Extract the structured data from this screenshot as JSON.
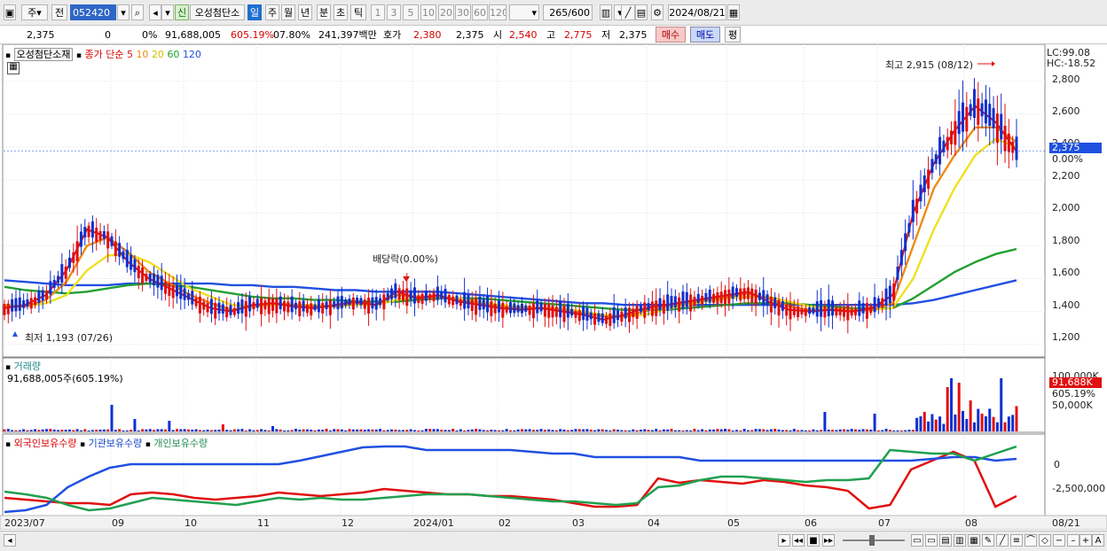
{
  "toolbar": {
    "mode_ju": "주",
    "mode_jeon": "전",
    "stock_code": "052420",
    "badge_sin": "신",
    "stock_name": "오성첨단소",
    "periods": [
      "일",
      "주",
      "월",
      "년",
      "분",
      "초",
      "틱"
    ],
    "numbers": [
      "1",
      "3",
      "5",
      "10",
      "20",
      "30",
      "60",
      "120"
    ],
    "count": "265",
    "count_total": "/600",
    "date": "2024/08/21"
  },
  "info": {
    "price": "2,375",
    "change": "0",
    "change_pct": "0%",
    "volume": "91,688,005",
    "vol_ratio": "605.19%",
    "turnover": "07.80%",
    "amount": "241,397백만",
    "hoga_label": "호가",
    "hoga_val": "2,380",
    "hoga_val2": "2,375",
    "open_label": "시",
    "open_val": "2,540",
    "high_label": "고",
    "high_val": "2,775",
    "low_label": "저",
    "low_val": "2,375",
    "buy": "매수",
    "sell": "매도",
    "eval": "평"
  },
  "price_panel": {
    "name": "오성첨단소재",
    "ma_label": "종가 단순",
    "ma_periods": [
      "5",
      "10",
      "20",
      "60",
      "120"
    ],
    "lc": "LC:99.08",
    "hc": "HC:-18.52",
    "high_note": "최고 2,915 (08/12)",
    "low_note": "최저 1,193 (07/26)",
    "div_note": "배당락(0.00%)",
    "current_tag": "2,375",
    "current_tag2": "0.00%",
    "y_ticks": [
      "2,800",
      "2,600",
      "2,400",
      "2,200",
      "2,000",
      "1,800",
      "1,600",
      "1,400",
      "1,200"
    ]
  },
  "volume_panel": {
    "name": "거래량",
    "value": "91,688,005주(605.19%)",
    "tick_top": "100,000K",
    "tick_mid": "50,000K",
    "tag1": "91,688K",
    "tag2": "605.19%"
  },
  "holdings_panel": {
    "foreign": "외국인보유수량",
    "inst": "기관보유수량",
    "indiv": "개인보유수량",
    "tick_zero": "0",
    "tick_neg": "-2,500,000"
  },
  "xaxis": [
    "2023/07",
    "09",
    "10",
    "11",
    "12",
    "2024/01",
    "02",
    "03",
    "04",
    "05",
    "06",
    "07",
    "08",
    "08/21"
  ],
  "colors": {
    "ma5": "#e01010",
    "ma10": "#f08a10",
    "ma20": "#f0e020",
    "ma60": "#20a030",
    "ma120": "#2050e0",
    "up": "#e01010",
    "down": "#1030d0"
  },
  "chart_data": {
    "type": "line",
    "title": "오성첨단소재",
    "series": [
      {
        "name": "5",
        "values": [
          1420,
          1440,
          1500,
          1650,
          1900,
          1850,
          1700,
          1600,
          1540,
          1480,
          1420,
          1400,
          1440,
          1450,
          1430,
          1420,
          1440,
          1460,
          1440,
          1520,
          1480,
          1500,
          1460,
          1440,
          1420,
          1410,
          1420,
          1400,
          1380,
          1350,
          1380,
          1420,
          1440,
          1460,
          1480,
          1500,
          1520,
          1460,
          1410,
          1400,
          1410,
          1400,
          1420,
          1500,
          2000,
          2300,
          2500,
          2650,
          2550,
          2375
        ]
      },
      {
        "name": "10",
        "values": [
          1430,
          1430,
          1470,
          1580,
          1800,
          1850,
          1760,
          1640,
          1570,
          1500,
          1450,
          1410,
          1430,
          1450,
          1440,
          1430,
          1430,
          1450,
          1440,
          1500,
          1490,
          1490,
          1470,
          1450,
          1430,
          1420,
          1420,
          1410,
          1390,
          1370,
          1370,
          1400,
          1430,
          1450,
          1470,
          1490,
          1510,
          1480,
          1430,
          1410,
          1410,
          1400,
          1410,
          1450,
          1800,
          2150,
          2350,
          2520,
          2520,
          2430
        ]
      },
      {
        "name": "20",
        "values": [
          1440,
          1430,
          1450,
          1500,
          1650,
          1740,
          1750,
          1700,
          1620,
          1540,
          1490,
          1440,
          1430,
          1440,
          1440,
          1440,
          1430,
          1440,
          1440,
          1470,
          1490,
          1490,
          1480,
          1460,
          1440,
          1430,
          1420,
          1420,
          1400,
          1380,
          1370,
          1380,
          1410,
          1440,
          1460,
          1480,
          1490,
          1490,
          1460,
          1430,
          1420,
          1410,
          1410,
          1420,
          1600,
          1900,
          2150,
          2350,
          2450,
          2400
        ]
      },
      {
        "name": "60",
        "values": [
          1550,
          1530,
          1520,
          1510,
          1520,
          1540,
          1560,
          1570,
          1560,
          1550,
          1530,
          1510,
          1490,
          1480,
          1480,
          1470,
          1470,
          1460,
          1460,
          1460,
          1470,
          1480,
          1480,
          1480,
          1470,
          1460,
          1450,
          1440,
          1430,
          1420,
          1410,
          1410,
          1410,
          1420,
          1430,
          1440,
          1450,
          1450,
          1450,
          1440,
          1430,
          1420,
          1420,
          1420,
          1480,
          1560,
          1640,
          1700,
          1750,
          1780
        ]
      },
      {
        "name": "120",
        "values": [
          1590,
          1580,
          1570,
          1560,
          1560,
          1560,
          1570,
          1570,
          1570,
          1570,
          1570,
          1560,
          1560,
          1550,
          1550,
          1540,
          1530,
          1530,
          1520,
          1520,
          1520,
          1520,
          1510,
          1500,
          1490,
          1480,
          1470,
          1460,
          1450,
          1450,
          1440,
          1440,
          1440,
          1440,
          1440,
          1440,
          1440,
          1440,
          1440,
          1440,
          1440,
          1440,
          1440,
          1440,
          1450,
          1470,
          1500,
          1530,
          1560,
          1590
        ]
      }
    ],
    "ylim": [
      1150,
      2950
    ]
  }
}
